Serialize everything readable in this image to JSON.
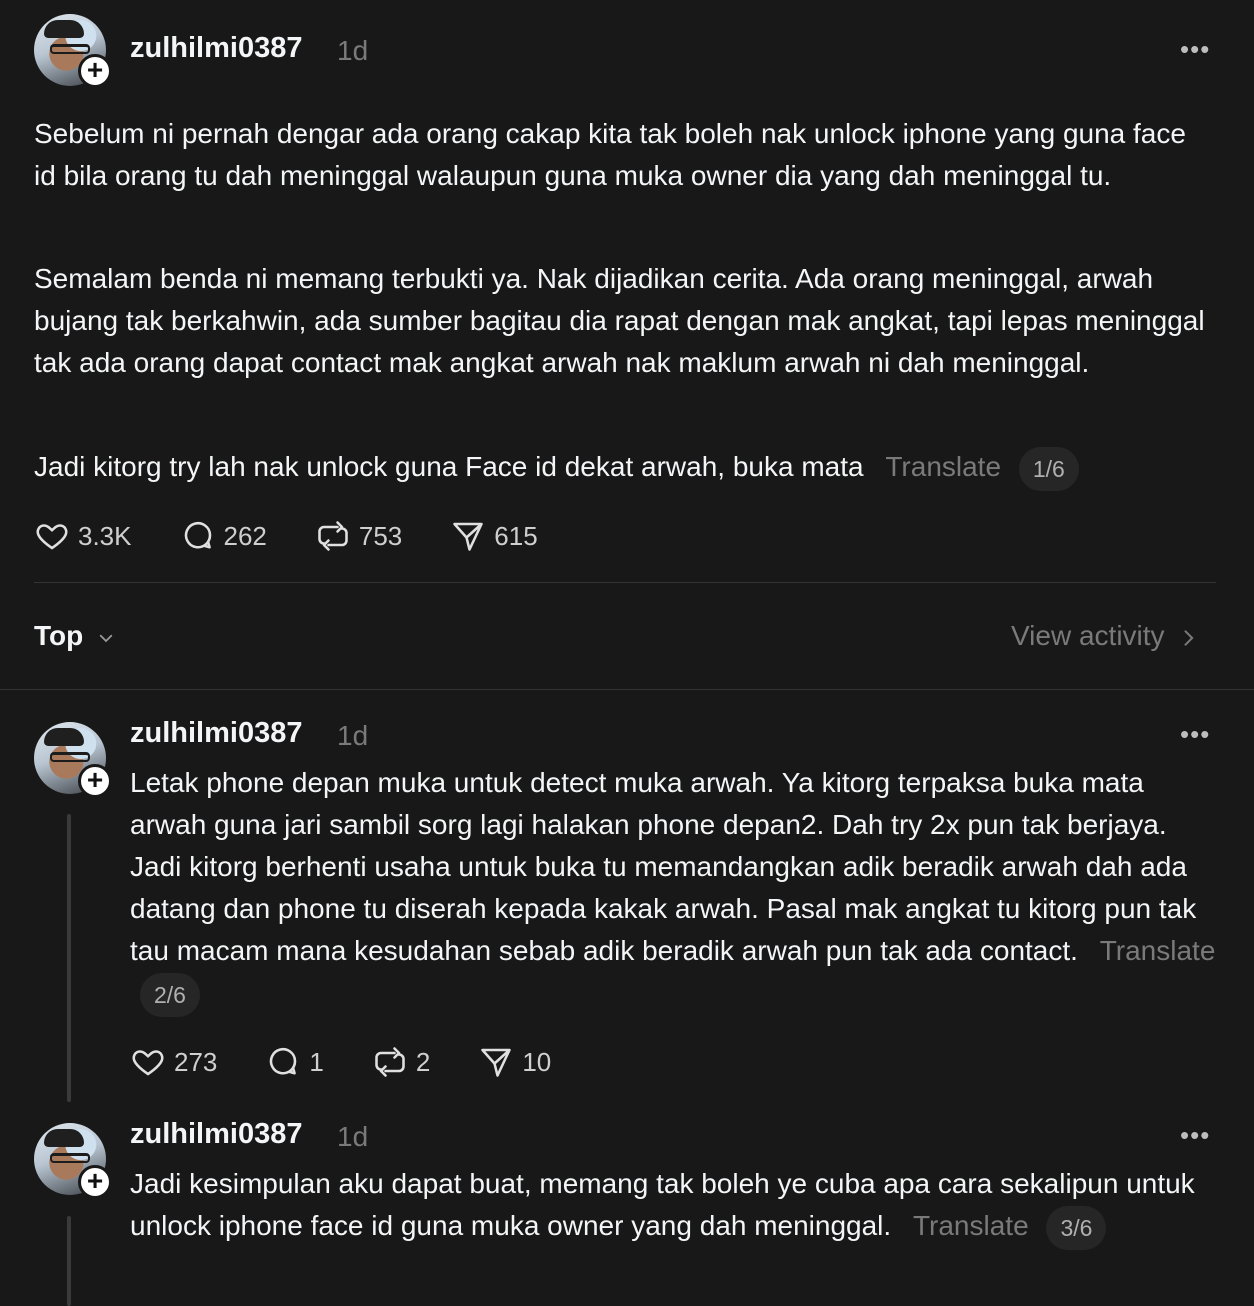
{
  "post": {
    "username": "zulhilmi0387",
    "time": "1d",
    "more": "•••",
    "paragraphs": [
      "Sebelum ni pernah dengar ada orang cakap kita tak boleh nak unlock iphone yang guna face id bila orang tu dah meninggal walaupun guna muka owner dia yang dah meninggal tu.",
      "Semalam benda ni memang terbukti ya. Nak dijadikan cerita. Ada orang meninggal, arwah bujang tak berkahwin, ada sumber bagitau dia rapat dengan mak angkat, tapi lepas meninggal tak ada orang dapat contact mak angkat arwah nak maklum arwah ni dah meninggal.",
      "Jadi kitorg try lah nak unlock guna Face id dekat arwah, buka mata"
    ],
    "translate": "Translate",
    "pager": "1/6",
    "likes": "3.3K",
    "replies": "262",
    "reposts": "753",
    "shares": "615"
  },
  "filter": {
    "sort_label": "Top",
    "view_activity": "View activity"
  },
  "replies": [
    {
      "username": "zulhilmi0387",
      "time": "1d",
      "more": "•••",
      "text": "Letak phone depan muka untuk detect muka arwah. Ya kitorg terpaksa buka mata arwah guna jari sambil sorg lagi halakan phone depan2. Dah try 2x pun tak berjaya. Jadi kitorg berhenti usaha untuk buka tu memandangkan adik beradik arwah dah ada datang dan phone tu diserah kepada kakak arwah. Pasal mak angkat tu kitorg pun tak tau macam mana kesudahan sebab adik beradik arwah pun tak ada contact.",
      "translate": "Translate",
      "pager": "2/6",
      "likes": "273",
      "replies": "1",
      "reposts": "2",
      "shares": "10"
    },
    {
      "username": "zulhilmi0387",
      "time": "1d",
      "more": "•••",
      "text": "Jadi kesimpulan aku dapat buat, memang tak boleh ye cuba apa cara sekalipun untuk unlock iphone face id guna muka owner yang dah meninggal.",
      "translate": "Translate",
      "pager": "3/6"
    }
  ]
}
